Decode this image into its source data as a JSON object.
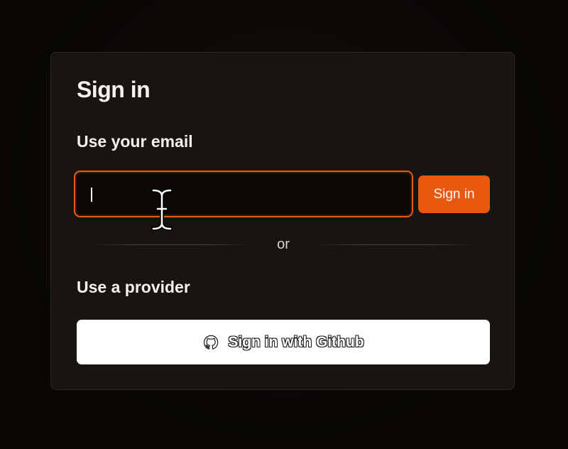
{
  "card": {
    "title": "Sign in",
    "email_section_label": "Use your email",
    "email_input": {
      "value": "",
      "placeholder": ""
    },
    "signin_button_label": "Sign in",
    "divider_text": "or",
    "provider_section_label": "Use a provider",
    "github_button": {
      "label": "Sign in with Github",
      "icon": "github-icon"
    }
  },
  "colors": {
    "accent": "#e8580e",
    "card_bg": "#171412",
    "page_bg": "#0a0807",
    "text": "#f4f1ee"
  }
}
